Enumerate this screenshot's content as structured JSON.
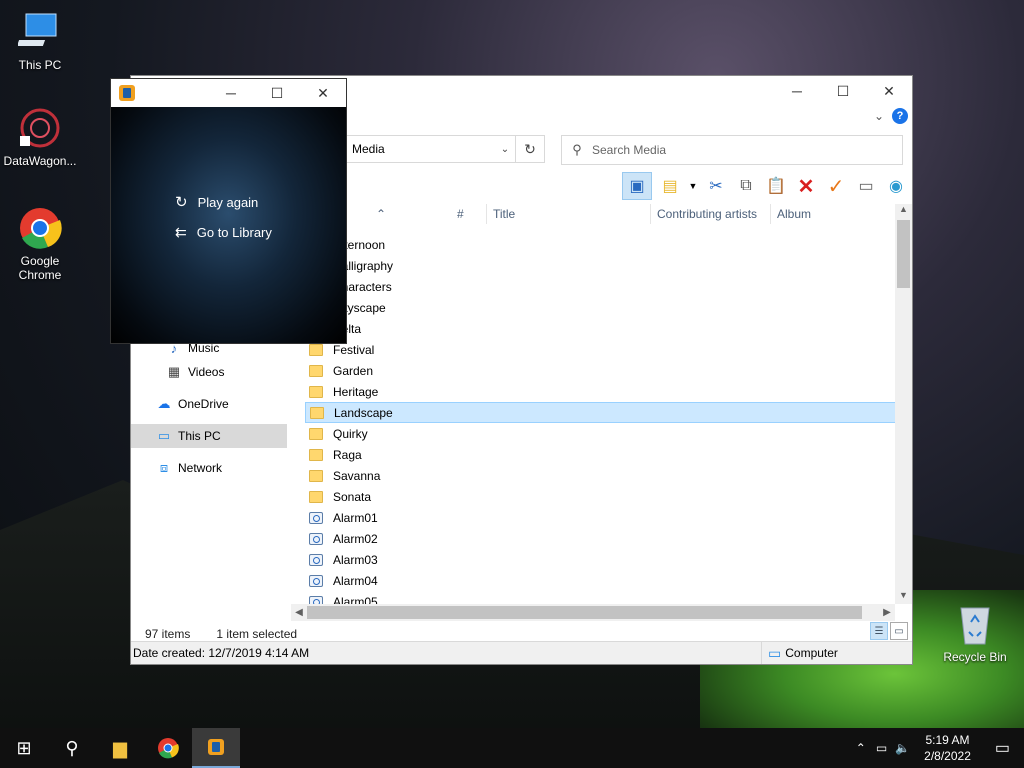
{
  "desktop": {
    "icons": [
      {
        "label": "This PC"
      },
      {
        "label": "DataWagon..."
      },
      {
        "label": "Google Chrome"
      },
      {
        "label": "Recycle Bin"
      }
    ]
  },
  "player": {
    "actions": [
      "Play again",
      "Go to Library"
    ]
  },
  "explorer": {
    "address": "Media",
    "search_placeholder": "Search Media",
    "columns": [
      "#",
      "Title",
      "Contributing artists",
      "Album"
    ],
    "nav": [
      {
        "label": "Music"
      },
      {
        "label": "Videos"
      },
      {
        "label": "OneDrive"
      },
      {
        "label": "This PC"
      },
      {
        "label": "Network"
      }
    ],
    "files": [
      {
        "name": "Afternoon",
        "type": "folder"
      },
      {
        "name": "Calligraphy",
        "type": "folder"
      },
      {
        "name": "Characters",
        "type": "folder"
      },
      {
        "name": "Cityscape",
        "type": "folder"
      },
      {
        "name": "Delta",
        "type": "folder"
      },
      {
        "name": "Festival",
        "type": "folder"
      },
      {
        "name": "Garden",
        "type": "folder"
      },
      {
        "name": "Heritage",
        "type": "folder"
      },
      {
        "name": "Landscape",
        "type": "folder"
      },
      {
        "name": "Quirky",
        "type": "folder"
      },
      {
        "name": "Raga",
        "type": "folder"
      },
      {
        "name": "Savanna",
        "type": "folder"
      },
      {
        "name": "Sonata",
        "type": "folder"
      },
      {
        "name": "Alarm01",
        "type": "audio"
      },
      {
        "name": "Alarm02",
        "type": "audio"
      },
      {
        "name": "Alarm03",
        "type": "audio"
      },
      {
        "name": "Alarm04",
        "type": "audio"
      },
      {
        "name": "Alarm05",
        "type": "audio"
      }
    ],
    "status": {
      "count": "97 items",
      "selected": "1 item selected"
    },
    "details": {
      "date_created": "Date created: 12/7/2019 4:14 AM",
      "location": "Computer"
    }
  },
  "taskbar": {
    "time": "5:19 AM",
    "date": "2/8/2022"
  }
}
